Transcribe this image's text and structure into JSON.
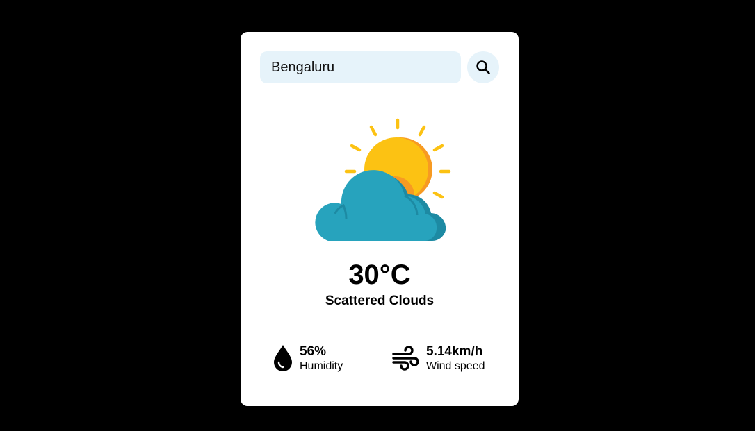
{
  "search": {
    "value": "Bengaluru",
    "placeholder": "",
    "button_icon": "search-icon"
  },
  "weather": {
    "icon": "partly-cloudy-icon",
    "temperature": "30°C",
    "description": "Scattered Clouds"
  },
  "stats": {
    "humidity": {
      "icon": "water-drop-icon",
      "value": "56%",
      "label": "Humidity"
    },
    "wind": {
      "icon": "wind-icon",
      "value": "5.14km/h",
      "label": "Wind speed"
    }
  },
  "colors": {
    "background": "#000000",
    "card": "#ffffff",
    "search_field": "#e6f3fa",
    "sun": "#fcc213",
    "sun_shadow": "#f79a22",
    "cloud": "#27a3bd",
    "cloud_shadow": "#1d8aa3"
  }
}
